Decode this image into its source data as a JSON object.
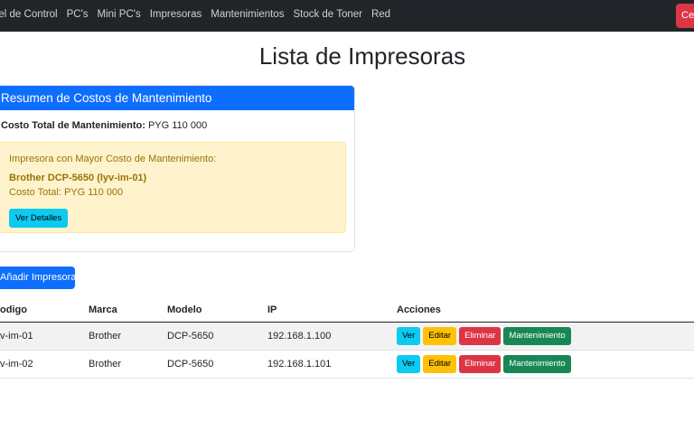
{
  "nav": {
    "items": [
      "nel de Control",
      "PC's",
      "Mini PC's",
      "Impresoras",
      "Mantenimientos",
      "Stock de Toner",
      "Red"
    ],
    "right_button": "Cer"
  },
  "page_title": "Lista de Impresoras",
  "summary": {
    "header": "Resumen de Costos de Mantenimiento",
    "total_label": "Costo Total de Mantenimiento:",
    "total_value": "PYG 110 000",
    "alert": {
      "title": "Impresora con Mayor Costo de Mantenimiento:",
      "printer": "Brother DCP-5650 (lyv-im-01)",
      "cost": "Costo Total: PYG 110 000",
      "details_button": "Ver Detalles"
    }
  },
  "add_button": "Añadir Impresora",
  "table": {
    "headers": [
      "odigo",
      "Marca",
      "Modelo",
      "IP",
      "Acciones"
    ],
    "rows": [
      {
        "codigo": "v-im-01",
        "marca": "Brother",
        "modelo": "DCP-5650",
        "ip": "192.168.1.100"
      },
      {
        "codigo": "v-im-02",
        "marca": "Brother",
        "modelo": "DCP-5650",
        "ip": "192.168.1.101"
      }
    ],
    "actions": {
      "view": "Ver",
      "edit": "Editar",
      "delete": "Eliminar",
      "maintenance": "Mantenimiento"
    }
  },
  "colors": {
    "navbar": "#212529",
    "primary": "#0d6efd",
    "info": "#0dcaf0",
    "warning": "#ffc107",
    "danger": "#dc3545",
    "success": "#198754",
    "alert_bg": "#fff3cd",
    "alert_text": "#997404"
  }
}
